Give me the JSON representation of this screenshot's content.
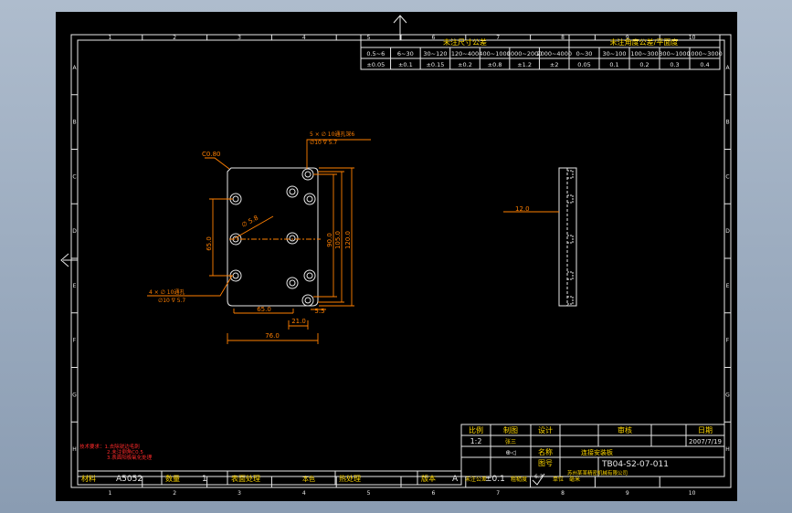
{
  "zones_top": [
    "1",
    "2",
    "3",
    "4",
    "5",
    "6",
    "7",
    "8",
    "9",
    "10"
  ],
  "zones_side": [
    "A",
    "B",
    "C",
    "D",
    "E",
    "F",
    "G",
    "H"
  ],
  "tolerance_table": {
    "header_left": "未注尺寸公差",
    "header_right": "未注角度公差/平面度",
    "ranges_left": [
      "0.5~6",
      "6~30",
      "30~120",
      "120~400",
      "400~1000",
      "1000~2000",
      "2000~4000"
    ],
    "values_left": [
      "±0.05",
      "±0.1",
      "±0.15",
      "±0.2",
      "±0.8",
      "±1.2",
      "±2"
    ],
    "ranges_right": [
      "0~30",
      "30~100",
      "100~300",
      "300~1000",
      "1000~3000"
    ],
    "values_right": [
      "0.05",
      "0.1",
      "0.2",
      "0.3",
      "0.4"
    ]
  },
  "drawing": {
    "chamfer": "C0.80",
    "hole_note_top": "5 × ∅ 10通孔深6",
    "hole_note_top_cb": "∅10 ∇ 5.7",
    "center_hole": "∅ 5.8",
    "hole_note_left": "4 × ∅ 10通孔",
    "hole_note_left_cb": "∅10 ∇ 5.7",
    "dim_650": "65.0",
    "dim_210": "21.0",
    "dim_760": "76.0",
    "dim_55": "5.5",
    "dim_650_v": "65.0",
    "dim_900": "90.0",
    "dim_1050": "105.0",
    "dim_1200": "120.0",
    "side_dim": "12.0"
  },
  "notes": {
    "l1": "技术要求：1.去除锐边毛刺",
    "l2": "2.未注倒角C0.5",
    "l3": "3.表面阳极氧化处理"
  },
  "title_block": {
    "scale_label": "比例",
    "scale_value": "1:2",
    "drawn_label": "制图",
    "drawn_value": "张三",
    "design_label": "设计",
    "check_label": "审核",
    "date_label": "日期",
    "date_value": "2007/7/19",
    "proj_symbol": "⊕◁",
    "name_label": "名称",
    "name_value": "连接安装板",
    "mat_label": "材料",
    "mat_value": "A5052",
    "qty_label": "数量",
    "qty_value": "1",
    "surface_label": "表面处理",
    "surface_value": "本色",
    "heat_label": "热处理",
    "ver_label": "版本",
    "ver_value": "A",
    "tol_label": "未注公差",
    "tol_value": "±0.1",
    "rough_label": "粗糙度",
    "rough_value": "6.3",
    "drawing_no_label": "图号",
    "drawing_no_value": "TB04-S2-07-011",
    "company": "苏州某某精密机械有限公司",
    "unit_label": "单位",
    "unit_value": "毫米"
  }
}
